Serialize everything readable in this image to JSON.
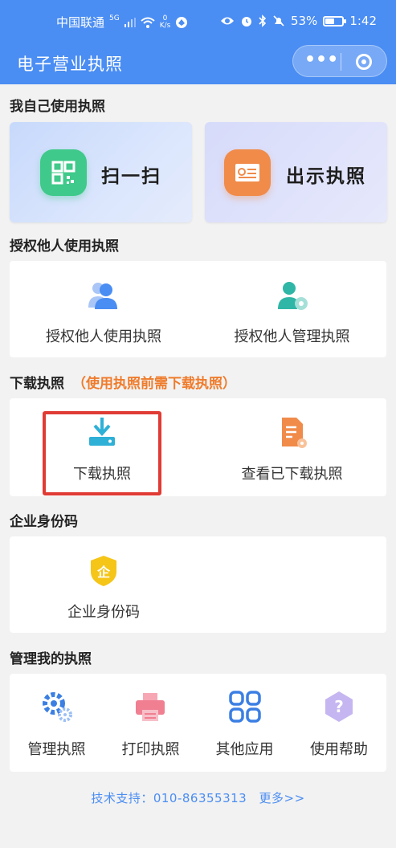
{
  "status_bar": {
    "carrier": "中国联通",
    "network": "5G",
    "net_speed_value": "0",
    "net_speed_unit": "K/s",
    "battery_percent": "53%",
    "battery_level": 0.53,
    "time": "1:42"
  },
  "title_bar": {
    "title": "电子营业执照",
    "more_icon": "ellipsis-icon",
    "close_icon": "target-close-icon"
  },
  "sections": {
    "self_use": {
      "title": "我自己使用执照",
      "scan_label": "扫一扫",
      "show_label": "出示执照"
    },
    "authorize": {
      "title": "授权他人使用执照",
      "use_label": "授权他人使用执照",
      "manage_label": "授权他人管理执照"
    },
    "download": {
      "title": "下载执照",
      "note": "（使用执照前需下载执照）",
      "download_label": "下载执照",
      "view_label": "查看已下载执照"
    },
    "enterprise_code": {
      "title": "企业身份码",
      "code_label": "企业身份码",
      "badge_char": "企"
    },
    "manage": {
      "title": "管理我的执照",
      "items": [
        {
          "label": "管理执照",
          "icon": "gear-icon"
        },
        {
          "label": "打印执照",
          "icon": "printer-icon"
        },
        {
          "label": "其他应用",
          "icon": "grid-icon"
        },
        {
          "label": "使用帮助",
          "icon": "help-icon"
        }
      ]
    }
  },
  "footer": {
    "text": "技术支持：010-86355313",
    "more": "更多>>"
  },
  "colors": {
    "header_blue": "#4a8df3",
    "accent_orange": "#ef7b2b",
    "highlight_red": "#e03b34"
  }
}
